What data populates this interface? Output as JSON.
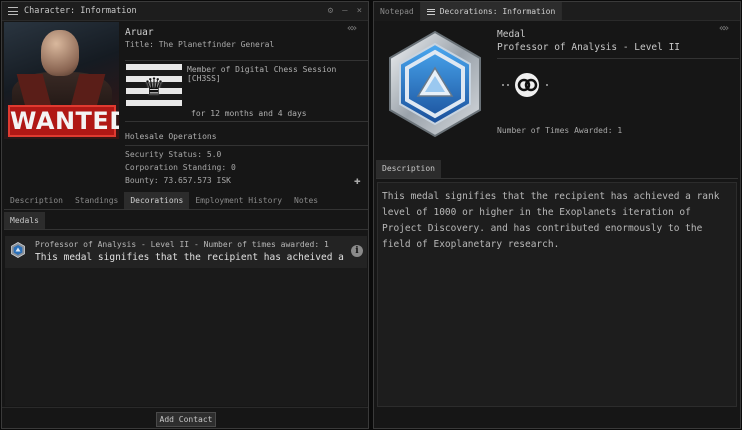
{
  "char_window": {
    "title": "Character: Information",
    "controls": [
      "⚙",
      "–",
      "×"
    ],
    "collapse_glyph": "«»"
  },
  "portrait": {
    "wanted_label": "WANTED"
  },
  "character": {
    "name": "Aruar",
    "title": "Title: The Planetfinder General",
    "corp_member": "Member of Digital Chess Session [CH3SS]",
    "corp_duration": "for 12 months and 4 days",
    "alliance": "Holesale Operations",
    "security_status": "Security Status: 5.0",
    "corp_standing": "Corporation Standing: 0",
    "bounty": "Bounty: 73.657.573 ISK"
  },
  "tabs": [
    {
      "label": "Description",
      "active": false
    },
    {
      "label": "Standings",
      "active": false
    },
    {
      "label": "Decorations",
      "active": true
    },
    {
      "label": "Employment History",
      "active": false
    },
    {
      "label": "Notes",
      "active": false
    }
  ],
  "subtabs": {
    "medals": "Medals"
  },
  "medals": [
    {
      "line1": "Professor of Analysis - Level II - Number of times awarded: 1",
      "line2": "This medal signifies that the recipient has acheived a rank level of"
    }
  ],
  "buttons": {
    "add_contact": "Add Contact",
    "info": "i",
    "plus": "✚"
  },
  "deco_window": {
    "tab_notepad": "Notepad",
    "tab_decorations": "Decorations: Information",
    "collapse_glyph": "«»"
  },
  "medal_detail": {
    "type": "Medal",
    "name": "Professor of Analysis - Level II",
    "times_awarded": "Number of Times Awarded: 1",
    "description_tab": "Description",
    "description": "This medal signifies that the recipient has achieved a rank level of 1000 or higher in the Exoplanets iteration of Project Discovery. and has contributed enormously to the field of Exoplanetary research."
  },
  "colors": {
    "background": "#161616",
    "wanted_red": "#b01815",
    "medal_blue": "#2a7fd0",
    "medal_silver": "#c8ccd0"
  }
}
